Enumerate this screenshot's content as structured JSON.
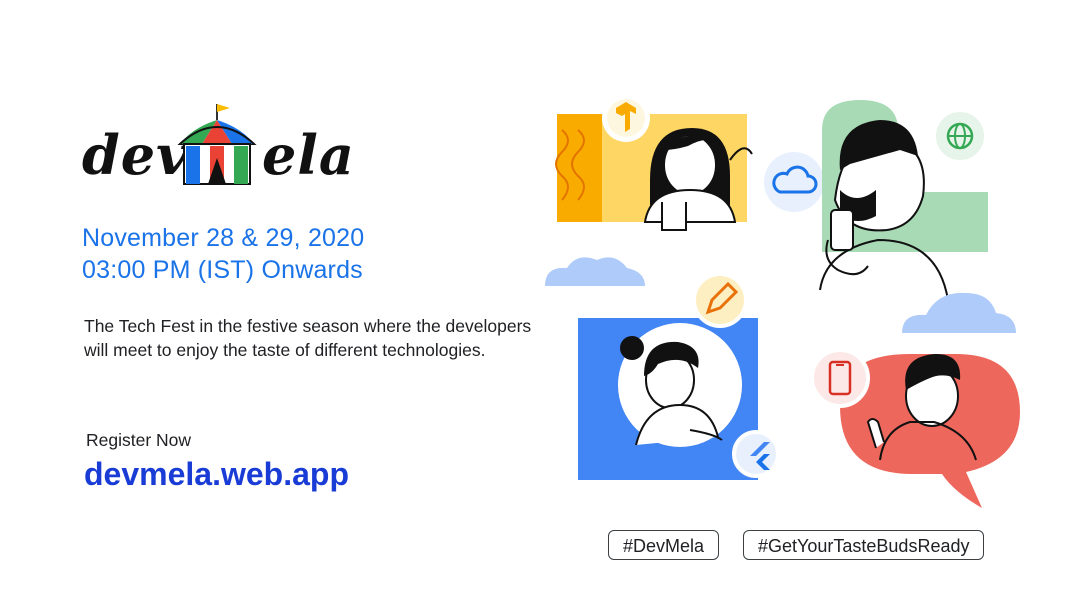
{
  "logo": {
    "left": "dev",
    "right": "ela",
    "alt": "devMela"
  },
  "event": {
    "date_line": "November 28 & 29, 2020",
    "time_line": "03:00 PM (IST) Onwards"
  },
  "description": "The Tech Fest in the festive season where the developers will meet to enjoy the taste of different technologies.",
  "register": {
    "label": "Register Now",
    "link": "devmela.web.app"
  },
  "tags": [
    "#DevMela",
    "#GetYourTasteBudsReady"
  ],
  "icons": [
    "tent-logo",
    "tensorflow-icon",
    "cloud-icon",
    "globe-icon",
    "pencil-icon",
    "phone-icon",
    "flutter-icon"
  ],
  "colors": {
    "blue": "#1a73e8",
    "link": "#1a3cd6",
    "yellow": "#fbbc04",
    "green": "#a8dab5",
    "red": "#ee675c",
    "cloud": "#aecbfa"
  }
}
